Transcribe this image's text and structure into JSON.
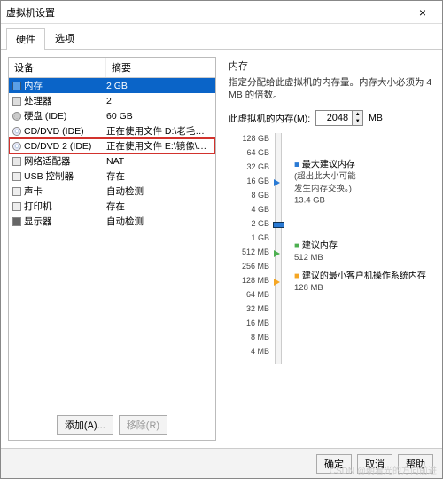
{
  "window": {
    "title": "虚拟机设置"
  },
  "tabs": [
    {
      "label": "硬件",
      "active": true
    },
    {
      "label": "选项",
      "active": false
    }
  ],
  "grid": {
    "headers": {
      "device": "设备",
      "summary": "摘要"
    },
    "rows": [
      {
        "icon": "mem",
        "name": "内存",
        "summary": "2 GB",
        "selected": true
      },
      {
        "icon": "cpu",
        "name": "处理器",
        "summary": "2"
      },
      {
        "icon": "disk",
        "name": "硬盘 (IDE)",
        "summary": "60 GB"
      },
      {
        "icon": "cd",
        "name": "CD/DVD (IDE)",
        "summary": "正在使用文件 D:\\老毛桃ISO\\La..."
      },
      {
        "icon": "cd",
        "name": "CD/DVD 2 (IDE)",
        "summary": "正在使用文件 E:\\镜像\\XTC_GH...",
        "highlight": true
      },
      {
        "icon": "net",
        "name": "网络适配器",
        "summary": "NAT"
      },
      {
        "icon": "usb",
        "name": "USB 控制器",
        "summary": "存在"
      },
      {
        "icon": "snd",
        "name": "声卡",
        "summary": "自动检测"
      },
      {
        "icon": "prn",
        "name": "打印机",
        "summary": "存在"
      },
      {
        "icon": "disp",
        "name": "显示器",
        "summary": "自动检测"
      }
    ],
    "buttons": {
      "add": "添加(A)...",
      "remove": "移除(R)"
    }
  },
  "right": {
    "heading": "内存",
    "desc": "指定分配给此虚拟机的内存量。内存大小必须为 4 MB 的倍数。",
    "field_label": "此虚拟机的内存(M):",
    "field_value": "2048",
    "field_unit": "MB",
    "ticks": [
      "128 GB",
      "64 GB",
      "32 GB",
      "16 GB",
      "8 GB",
      "4 GB",
      "2 GB",
      "1 GB",
      "512 MB",
      "256 MB",
      "128 MB",
      "64 MB",
      "32 MB",
      "16 MB",
      "8 MB",
      "4 MB"
    ],
    "markers": {
      "max": {
        "title": "最大建议内存",
        "sub1": "(超出此大小可能",
        "sub2": "发生内存交换。)",
        "value": "13.4 GB"
      },
      "rec": {
        "title": "建议内存",
        "value": "512 MB"
      },
      "guest": {
        "title": "建议的最小客户机操作系统内存",
        "value": "128 MB"
      }
    }
  },
  "footer": {
    "ok": "确定",
    "cancel": "取消",
    "help": "帮助"
  },
  "watermark": "CSDN @朝着光的方向前进"
}
